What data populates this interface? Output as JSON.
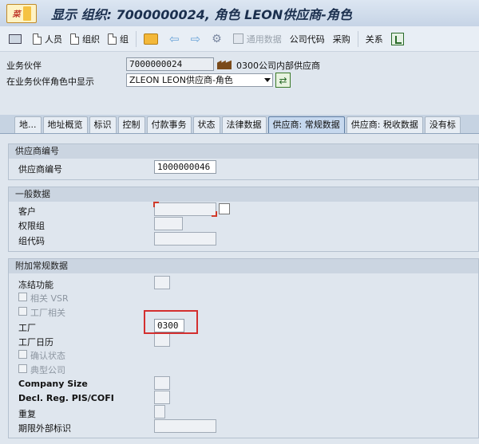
{
  "title": {
    "menu_icon": "sap-menu-icon",
    "window_title": "显示 组织: 7000000024, 角色 LEON供应商-角色"
  },
  "toolbar": {
    "items": [
      {
        "label": "人员"
      },
      {
        "label": "组织"
      },
      {
        "label": "组"
      },
      {
        "label": "通用数据"
      },
      {
        "label": "公司代码"
      },
      {
        "label": "采购"
      },
      {
        "label": "关系"
      }
    ]
  },
  "header": {
    "partner_label": "业务伙伴",
    "partner_value": "7000000024",
    "partner_desc": "0300公司内部供应商",
    "role_label": "在业务伙伴角色中显示",
    "role_value": "ZLEON LEON供应商-角色"
  },
  "tabs": [
    {
      "label": "地..."
    },
    {
      "label": "地址概览"
    },
    {
      "label": "标识"
    },
    {
      "label": "控制"
    },
    {
      "label": "付款事务"
    },
    {
      "label": "状态"
    },
    {
      "label": "法律数据"
    },
    {
      "label": "供应商: 常规数据",
      "active": true
    },
    {
      "label": "供应商: 税收数据"
    },
    {
      "label": "没有标"
    }
  ],
  "groups": {
    "vendor_no": {
      "heading": "供应商编号",
      "label": "供应商编号",
      "value": "1000000046"
    },
    "general": {
      "heading": "一般数据",
      "customer_label": "客户",
      "auth_group_label": "权限组",
      "group_key_label": "组代码"
    },
    "additional": {
      "heading": "附加常规数据",
      "freeze_label": "冻结功能",
      "vsr_label": "相关 VSR",
      "plant_related_label": "工厂相关",
      "plant_label": "工厂",
      "plant_value": "0300",
      "factory_calendar_label": "工厂日历",
      "confirm_status_label": "确认状态",
      "typical_company_label": "典型公司",
      "company_size_label": "Company Size",
      "decl_reg_label": "Decl. Reg. PIS/COFI",
      "repeat_label": "重复",
      "term_ext_label": "期限外部标识"
    }
  },
  "colors": {
    "accent": "#d32f2f",
    "tab_active": "#c6d8ee"
  }
}
